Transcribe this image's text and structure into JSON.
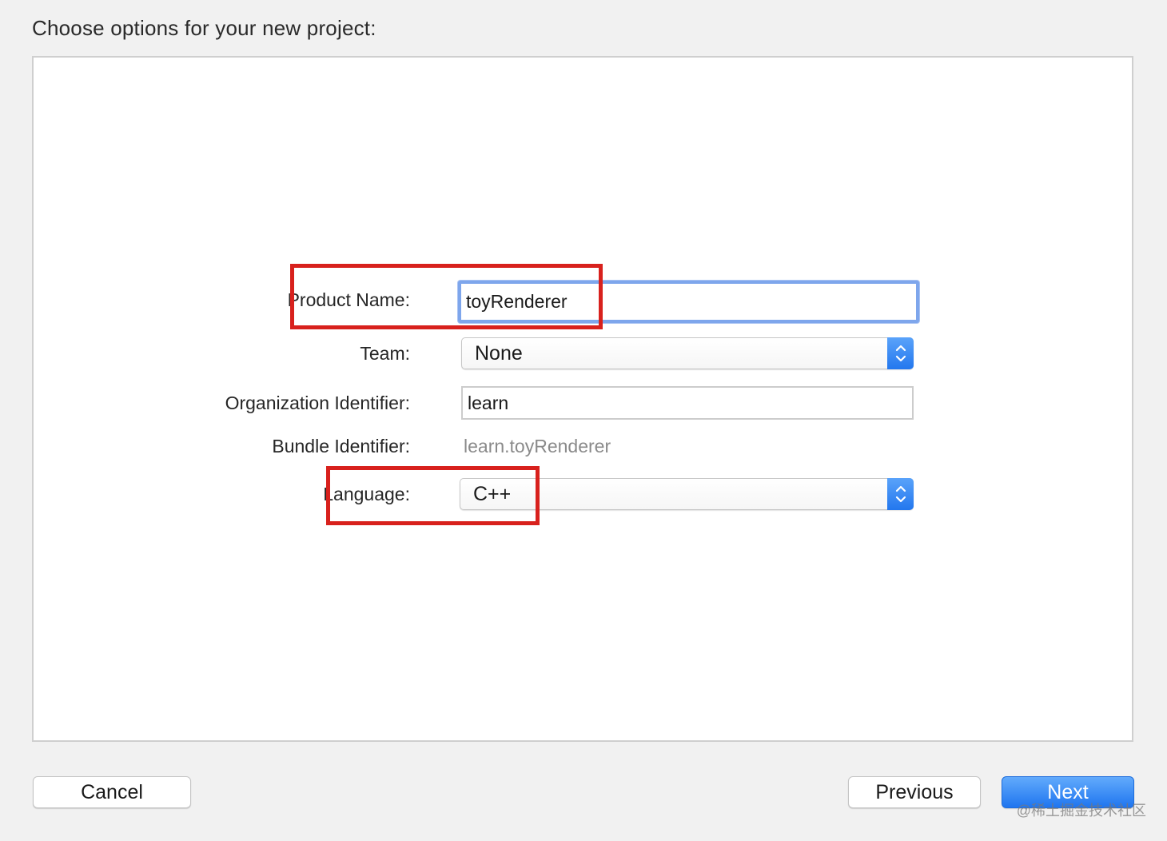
{
  "dialog": {
    "heading": "Choose options for your new project:"
  },
  "form": {
    "product_name": {
      "label": "Product Name:",
      "value": "toyRenderer"
    },
    "team": {
      "label": "Team:",
      "value": "None"
    },
    "organization_identifier": {
      "label": "Organization Identifier:",
      "value": "learn"
    },
    "bundle_identifier": {
      "label": "Bundle Identifier:",
      "value": "learn.toyRenderer"
    },
    "language": {
      "label": "Language:",
      "value": "C++"
    }
  },
  "buttons": {
    "cancel": "Cancel",
    "previous": "Previous",
    "next": "Next"
  },
  "watermark": "@稀土掘金技术社区",
  "colors": {
    "highlight_box": "#d8211d",
    "focus_ring": "#7ea6ec",
    "accent": "#2377ee"
  }
}
